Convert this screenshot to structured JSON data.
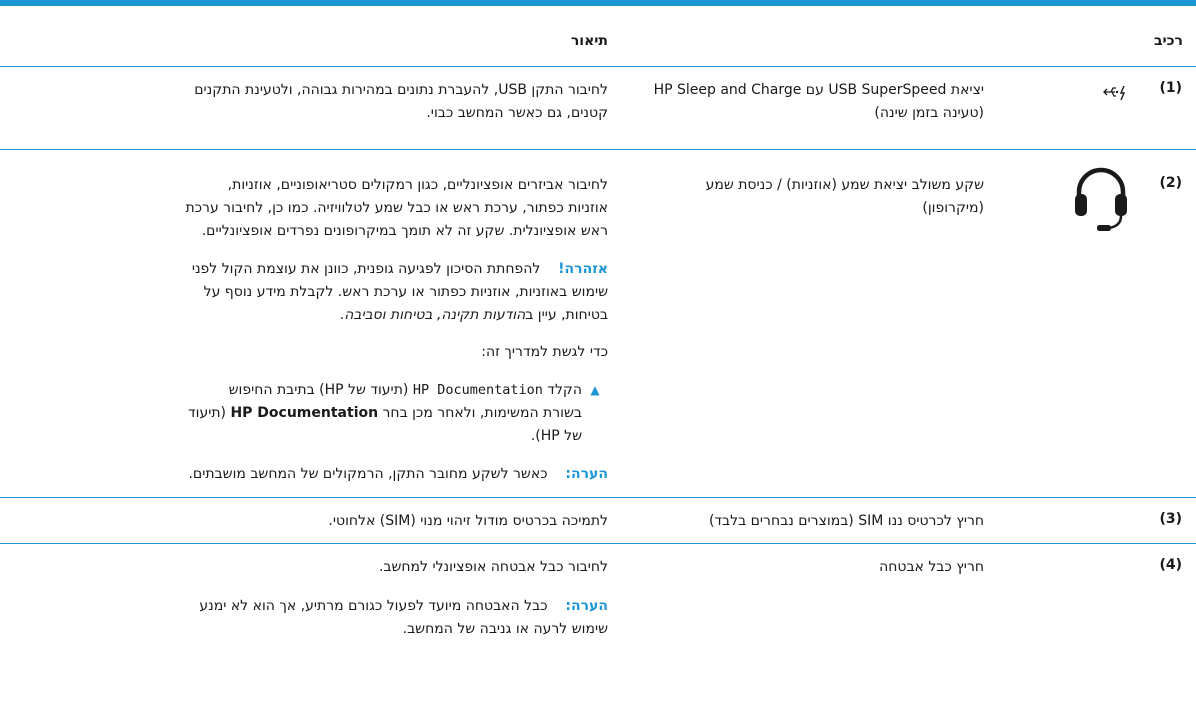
{
  "colors": {
    "accent": "#1d97d4"
  },
  "table": {
    "headers": {
      "component": "רכיב",
      "description": "תיאור"
    },
    "rows": [
      {
        "number": "(1)",
        "icon": "usb-superspeed-charge-icon",
        "icon_text": "ss",
        "name_line1": "יציאת USB SuperSpeed עם HP Sleep and Charge",
        "name_line2": "(טעינה בזמן שינה)",
        "desc_line1": "לחיבור התקן USB, להעברת נתונים במהירות גבוהה, ולטעינת התקנים",
        "desc_line2": "קטנים, גם כאשר המחשב כבוי."
      },
      {
        "number": "(2)",
        "icon": "headset-icon",
        "name_line1": "שקע משולב יציאת שמע (אוזניות) / כניסת שמע",
        "name_line2": "(מיקרופון)",
        "desc_line1": "לחיבור אביזרים אופציונליים, כגון רמקולים סטריאופוניים, אוזניות,",
        "desc_line2": "אוזניות כפתור, ערכת ראש או כבל שמע לטלוויזיה. כמו כן, לחיבור ערכת",
        "desc_line3": "ראש אופציונלית. שקע זה לא תומך במיקרופונים נפרדים אופציונליים.",
        "warning_label": "אזהרה!",
        "warning_line1": "להפחתת הסיכון לפגיעה גופנית, כוונן את עוצמת הקול לפני",
        "warning_line2": "שימוש באוזניות, אוזניות כפתור או ערכת ראש. לקבלת מידע נוסף על",
        "warning_line3_prefix": "בטיחות, עיין ב",
        "warning_line3_link": "הודעות תקינה, בטיחות וסביבה",
        "warning_line3_suffix": ".",
        "guide_text": "כדי לגשת למדריך זה:",
        "step_marker": "▲",
        "step_prefix": "הקלד ",
        "step_code": "HP Documentation",
        "step_mid": " (תיעוד של HP) בתיבת החיפוש",
        "step_line2_prefix": "בשורת המשימות, ולאחר מכן בחר ",
        "step_line2_bold": "HP Documentation",
        "step_line2_suffix": " (תיעוד",
        "step_line3": "של HP).",
        "note_label": "הערה:",
        "note_text": "כאשר לשקע מחובר התקן, הרמקולים של המחשב מושבתים."
      },
      {
        "number": "(3)",
        "name_line1": "חריץ לכרטיס ננו SIM (במוצרים נבחרים בלבד)",
        "desc_line1": "לתמיכה בכרטיס מודול זיהוי מנוי (SIM) אלחוטי."
      },
      {
        "number": "(4)",
        "name_line1": "חריץ כבל אבטחה",
        "desc_line1": "לחיבור כבל אבטחה אופציונלי למחשב.",
        "note_label": "הערה:",
        "note_line1": "כבל האבטחה מיועד לפעול כגורם מרתיע, אך הוא לא ימנע",
        "note_line2": "שימוש לרעה או גניבה של המחשב."
      }
    ]
  }
}
